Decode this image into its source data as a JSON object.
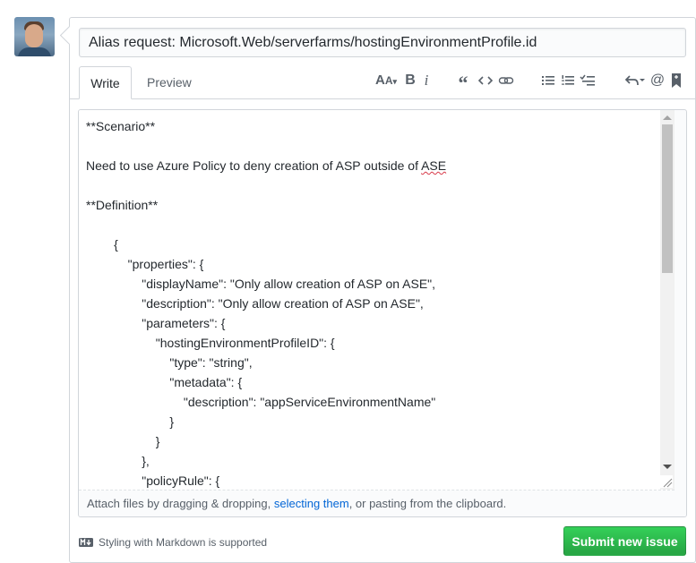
{
  "issue": {
    "title_value": "Alias request: Microsoft.Web/serverfarms/hostingEnvironmentProfile.id"
  },
  "tabs": [
    {
      "label": "Write",
      "active": true
    },
    {
      "label": "Preview",
      "active": false
    }
  ],
  "toolbar": {
    "items": [
      {
        "icon": "text-size-icon",
        "glyph": "AA▾"
      },
      {
        "icon": "bold-icon",
        "glyph": "B"
      },
      {
        "icon": "italic-icon",
        "glyph": "i"
      },
      {
        "icon": "quote-icon",
        "glyph": "❝"
      },
      {
        "icon": "code-icon",
        "glyph": "<>"
      },
      {
        "icon": "link-icon",
        "glyph": "⊶"
      },
      {
        "icon": "unordered-list-icon",
        "glyph": "≔"
      },
      {
        "icon": "ordered-list-icon",
        "glyph": "≡"
      },
      {
        "icon": "task-list-icon",
        "glyph": "☑"
      },
      {
        "icon": "reply-icon",
        "glyph": "↶▾"
      },
      {
        "icon": "mention-icon",
        "glyph": "@"
      },
      {
        "icon": "saved-reply-icon",
        "glyph": "🔖"
      }
    ]
  },
  "editor": {
    "lines": [
      "**Scenario**",
      "",
      "Need to use Azure Policy to deny creation of ASP outside of ASE",
      "",
      "**Definition**",
      "",
      "        {",
      "            \"properties\": {",
      "                \"displayName\": \"Only allow creation of ASP on ASE\",",
      "                \"description\": \"Only allow creation of ASP on ASE\",",
      "                \"parameters\": {",
      "                    \"hostingEnvironmentProfileID\": {",
      "                        \"type\": \"string\",",
      "                        \"metadata\": {",
      "                            \"description\": \"appServiceEnvironmentName\"",
      "                        }",
      "                    }",
      "                },",
      "                \"policyRule\": {"
    ],
    "attach_prefix": "Attach files by dragging & dropping, ",
    "attach_link": "selecting them",
    "attach_suffix": ", or pasting from the clipboard."
  },
  "footer": {
    "markdown_note": "Styling with Markdown is supported",
    "submit_label": "Submit new issue"
  },
  "colors": {
    "accent_link": "#0366d6",
    "submit_green": "#28a745"
  }
}
